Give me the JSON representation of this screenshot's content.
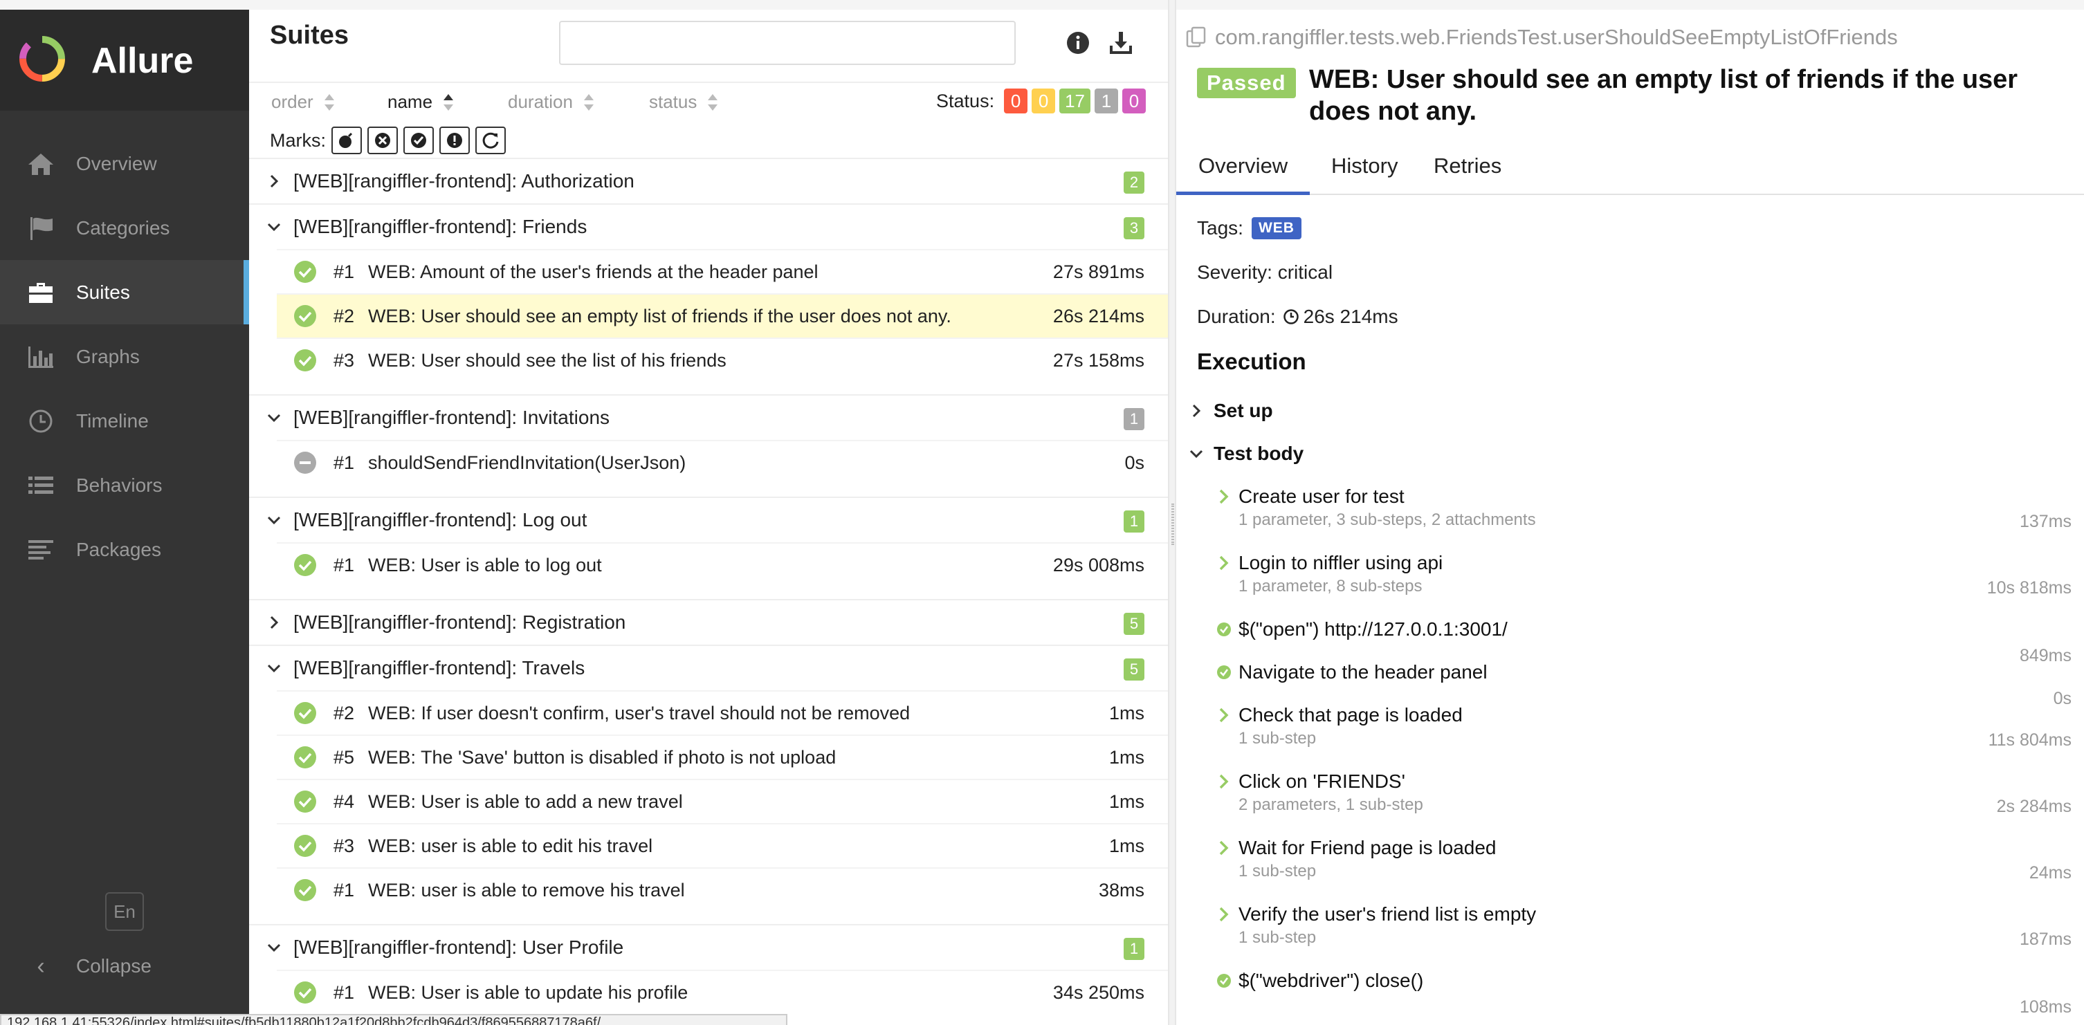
{
  "brand": {
    "name": "Allure"
  },
  "sidebar": {
    "items": [
      {
        "label": "Overview",
        "icon": "home-icon",
        "active": false
      },
      {
        "label": "Categories",
        "icon": "flag-icon",
        "active": false
      },
      {
        "label": "Suites",
        "icon": "briefcase-icon",
        "active": true
      },
      {
        "label": "Graphs",
        "icon": "bar-chart-icon",
        "active": false
      },
      {
        "label": "Timeline",
        "icon": "clock-icon",
        "active": false
      },
      {
        "label": "Behaviors",
        "icon": "list-icon",
        "active": false
      },
      {
        "label": "Packages",
        "icon": "align-left-icon",
        "active": false
      }
    ],
    "language": "En",
    "collapse_label": "Collapse"
  },
  "suites": {
    "title": "Suites",
    "search_value": "",
    "sort": {
      "order": "order",
      "name": "name",
      "duration": "duration",
      "status": "status"
    },
    "status_label": "Status:",
    "status_counts": [
      {
        "value": "0",
        "color": "#fd5a3e",
        "name": "failed"
      },
      {
        "value": "0",
        "color": "#ffd050",
        "name": "broken"
      },
      {
        "value": "17",
        "color": "#97cc64",
        "name": "passed"
      },
      {
        "value": "1",
        "color": "#aaaaaa",
        "name": "skipped"
      },
      {
        "value": "0",
        "color": "#d35ebe",
        "name": "unknown"
      }
    ],
    "marks_label": "Marks:",
    "groups": [
      {
        "name": "[WEB][rangiffler-frontend]: Authorization",
        "count": "2",
        "expanded": false,
        "tests": []
      },
      {
        "name": "[WEB][rangiffler-frontend]: Friends",
        "count": "3",
        "expanded": true,
        "tests": [
          {
            "num": "#1",
            "name": "WEB: Amount of the user's friends at the header panel",
            "duration": "27s 891ms",
            "status": "passed",
            "selected": false
          },
          {
            "num": "#2",
            "name": "WEB: User should see an empty list of friends if the user does not any.",
            "duration": "26s 214ms",
            "status": "passed",
            "selected": true
          },
          {
            "num": "#3",
            "name": "WEB: User should see the list of his friends",
            "duration": "27s 158ms",
            "status": "passed",
            "selected": false
          }
        ]
      },
      {
        "name": "[WEB][rangiffler-frontend]: Invitations",
        "count": "1",
        "expanded": true,
        "countColor": "grey",
        "tests": [
          {
            "num": "#1",
            "name": "shouldSendFriendInvitation(UserJson)",
            "duration": "0s",
            "status": "skipped",
            "selected": false
          }
        ]
      },
      {
        "name": "[WEB][rangiffler-frontend]: Log out",
        "count": "1",
        "expanded": true,
        "tests": [
          {
            "num": "#1",
            "name": "WEB: User is able to log out",
            "duration": "29s 008ms",
            "status": "passed",
            "selected": false
          }
        ]
      },
      {
        "name": "[WEB][rangiffler-frontend]: Registration",
        "count": "5",
        "expanded": false,
        "tests": []
      },
      {
        "name": "[WEB][rangiffler-frontend]: Travels",
        "count": "5",
        "expanded": true,
        "tests": [
          {
            "num": "#2",
            "name": "WEB: If user doesn't confirm, user's travel should not be removed",
            "duration": "1ms",
            "status": "passed",
            "selected": false
          },
          {
            "num": "#5",
            "name": "WEB: The 'Save' button is disabled if photo is not upload",
            "duration": "1ms",
            "status": "passed",
            "selected": false
          },
          {
            "num": "#4",
            "name": "WEB: User is able to add a new travel",
            "duration": "1ms",
            "status": "passed",
            "selected": false
          },
          {
            "num": "#3",
            "name": "WEB: user is able to edit his travel",
            "duration": "1ms",
            "status": "passed",
            "selected": false
          },
          {
            "num": "#1",
            "name": "WEB: user is able to remove his travel",
            "duration": "38ms",
            "status": "passed",
            "selected": false
          }
        ]
      },
      {
        "name": "[WEB][rangiffler-frontend]: User Profile",
        "count": "1",
        "expanded": true,
        "tests": [
          {
            "num": "#1",
            "name": "WEB: User is able to update his profile",
            "duration": "34s 250ms",
            "status": "passed",
            "selected": false
          }
        ]
      }
    ]
  },
  "test": {
    "full_name": "com.rangiffler.tests.web.FriendsTest.userShouldSeeEmptyListOfFriends",
    "status_label": "Passed",
    "title": "WEB: User should see an empty list of friends if the user does not any.",
    "tabs": [
      "Overview",
      "History",
      "Retries"
    ],
    "tags_label": "Tags:",
    "tag": "WEB",
    "severity": "Severity: critical",
    "duration_label": "Duration:",
    "duration": "26s 214ms",
    "execution_title": "Execution",
    "setup_label": "Set up",
    "body_label": "Test body",
    "steps": [
      {
        "name": "Create user for test",
        "sub": "1 parameter, 3 sub-steps, 2 attachments",
        "time": "137ms",
        "kind": "chevron"
      },
      {
        "name": "Login to niffler using api",
        "sub": "1 parameter, 8 sub-steps",
        "time": "10s 818ms",
        "kind": "chevron"
      },
      {
        "name": "$(\"open\") http://127.0.0.1:3001/",
        "sub": "",
        "time": "849ms",
        "kind": "check"
      },
      {
        "name": "Navigate to the header panel",
        "sub": "",
        "time": "0s",
        "kind": "check"
      },
      {
        "name": "Check that page is loaded",
        "sub": "1 sub-step",
        "time": "11s 804ms",
        "kind": "chevron"
      },
      {
        "name": "Click on 'FRIENDS'",
        "sub": "2 parameters, 1 sub-step",
        "time": "2s 284ms",
        "kind": "chevron"
      },
      {
        "name": "Wait for Friend page is loaded",
        "sub": "1 sub-step",
        "time": "24ms",
        "kind": "chevron"
      },
      {
        "name": "Verify the user's friend list is empty",
        "sub": "1 sub-step",
        "time": "187ms",
        "kind": "chevron"
      },
      {
        "name": "$(\"webdriver\") close()",
        "sub": "",
        "time": "108ms",
        "kind": "check"
      }
    ]
  },
  "statusbar": {
    "url": "192.168.1.41:55326/index.html#suites/fb5db11880b12a1f20d8bb2fcdb964d3/f869556887178a6f/"
  }
}
